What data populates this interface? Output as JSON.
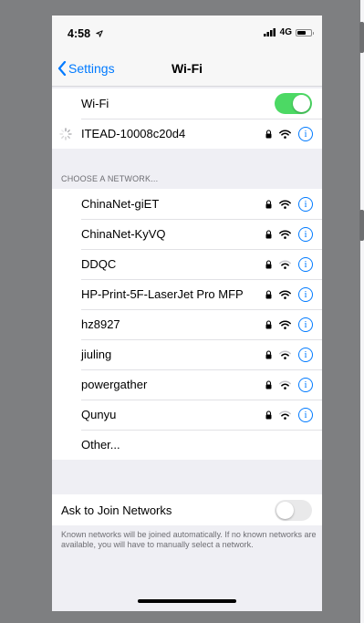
{
  "status_bar": {
    "time": "4:58",
    "network": "4G"
  },
  "nav": {
    "back_label": "Settings",
    "title": "Wi-Fi"
  },
  "wifi": {
    "label": "Wi-Fi",
    "enabled": true,
    "connecting_network": "ITEAD-10008c20d4"
  },
  "section_header": "CHOOSE A NETWORK...",
  "networks": [
    {
      "name": "ChinaNet-giET"
    },
    {
      "name": "ChinaNet-KyVQ"
    },
    {
      "name": "DDQC"
    },
    {
      "name": "HP-Print-5F-LaserJet Pro MFP"
    },
    {
      "name": "hz8927"
    },
    {
      "name": "jiuling"
    },
    {
      "name": "powergather"
    },
    {
      "name": "Qunyu"
    }
  ],
  "other_label": "Other...",
  "ask_to_join": {
    "label": "Ask to Join Networks",
    "enabled": false,
    "footnote": "Known networks will be joined automatically. If no known networks are available, you will have to manually select a network."
  },
  "icons": {
    "lock": "lock-icon",
    "wifi": "wifi-icon",
    "info": "info-icon",
    "info_glyph": "i"
  },
  "colors": {
    "accent": "#007aff",
    "toggle_on": "#4cd964",
    "toggle_off": "#e9e9ea"
  }
}
